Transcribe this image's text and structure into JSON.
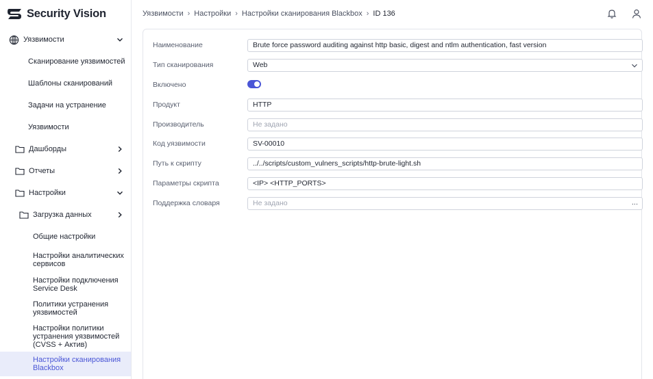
{
  "app": {
    "brand": "Security Vision"
  },
  "colors": {
    "accent": "#4a56d6",
    "active_bg": "#e9ecfa"
  },
  "sidebar": {
    "items": [
      {
        "label": "Уязвимости",
        "icon": "globe-icon",
        "expanded": true
      },
      {
        "label": "Сканирование уязвимостей"
      },
      {
        "label": "Шаблоны сканирований"
      },
      {
        "label": "Задачи на устранение"
      },
      {
        "label": "Уязвимости"
      },
      {
        "label": "Дашборды",
        "icon": "folder-icon"
      },
      {
        "label": "Отчеты",
        "icon": "folder-icon"
      },
      {
        "label": "Настройки",
        "icon": "folder-icon",
        "expanded": true
      },
      {
        "label": "Загрузка данных",
        "icon": "folder-icon"
      },
      {
        "label": "Общие настройки"
      },
      {
        "label": "Настройки аналитических сервисов"
      },
      {
        "label": "Настройки подключения Service Desk"
      },
      {
        "label": "Политики устранения уязвимостей"
      },
      {
        "label": "Настройки политики устранения уязвимостей (CVSS + Актив)"
      },
      {
        "label": "Настройки сканирования Blackbox",
        "active": true
      }
    ]
  },
  "breadcrumb": {
    "items": [
      "Уязвимости",
      "Настройки",
      "Настройки сканирования Blackbox"
    ],
    "current": "ID 136"
  },
  "topbar": {
    "icons": [
      "bell-icon",
      "user-icon"
    ]
  },
  "form": {
    "name": {
      "label": "Наименование",
      "value": "Brute force password auditing against http basic, digest and ntlm authentication, fast version"
    },
    "scan_type": {
      "label": "Тип сканирования",
      "value": "Web"
    },
    "enabled": {
      "label": "Включено",
      "value": true
    },
    "product": {
      "label": "Продукт",
      "value": "HTTP"
    },
    "vendor": {
      "label": "Производитель",
      "placeholder": "Не задано"
    },
    "vuln_code": {
      "label": "Код уязвимости",
      "value": "SV-00010"
    },
    "script_path": {
      "label": "Путь к скрипту",
      "value": "../../scripts/custom_vulners_scripts/http-brute-light.sh"
    },
    "script_params": {
      "label": "Параметры скрипта",
      "value": "<IP> <HTTP_PORTS>"
    },
    "dictionary": {
      "label": "Поддержка словаря",
      "placeholder": "Не задано",
      "button": "..."
    }
  }
}
